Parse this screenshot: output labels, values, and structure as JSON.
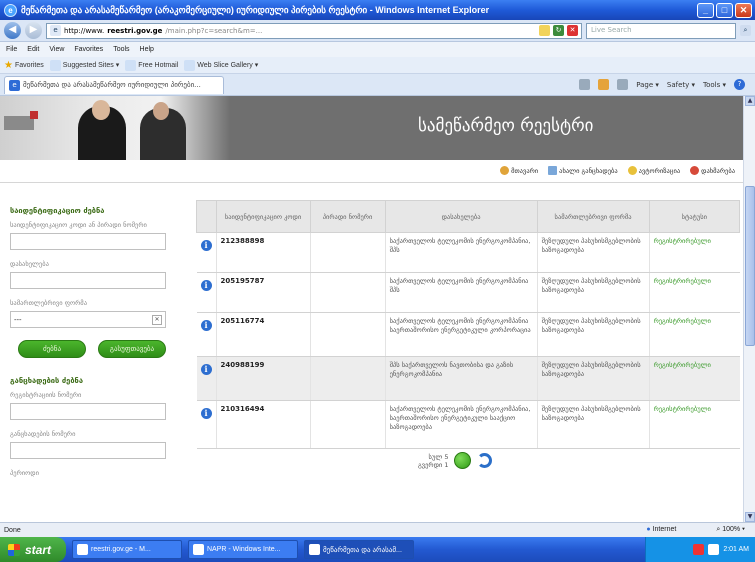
{
  "browser": {
    "title": "მეწარმეთა და არასამეწარმეო (არაკომერციული) იურიდიული პირების რეესტრი - Windows Internet Explorer",
    "url_http": "http://www.",
    "url_domain": "reestri.gov.ge",
    "url_path": "/main.php?c=search&m=...",
    "search_placeholder": "Live Search",
    "menu": [
      "File",
      "Edit",
      "View",
      "Favorites",
      "Tools",
      "Help"
    ],
    "favorites_label": "Favorites",
    "fav_items": [
      "Suggested Sites ▾",
      "Free Hotmail",
      "Web Slice Gallery ▾"
    ],
    "tab_title": "მეწარმეთა და არასამეწარმეო იურიდიული პირები...",
    "commands": [
      "Page ▾",
      "Safety ▾",
      "Tools ▾"
    ],
    "status_left": "Done",
    "status_zone": "Internet",
    "status_zoom": "100%"
  },
  "site": {
    "title": "სამეწარმეო რეესტრი",
    "toplinks": [
      "მთავარი",
      "ახალი განცხადება",
      "ავტორიზაცია",
      "დახმარება"
    ]
  },
  "sidebar": {
    "section1_title": "საიდენტიფიკაციო ძებნა",
    "field1_label": "საიდენტიფიკაციო კოდი ან პირადი ნომერი",
    "field2_label": "დასახელება",
    "field3_label": "სამართლებრივი ფორმა",
    "select_value": "---",
    "btn_search": "ძებნა",
    "btn_clear": "გასუფთავება",
    "section2_title": "განცხადების ძებნა",
    "field4_label": "რეგისტრაციის ნომერი",
    "field5_label": "განცხადების ნომერი",
    "field6_label": "პერიოდი"
  },
  "table": {
    "headers": [
      "საიდენტიფიკაციო კოდი",
      "პირადი ნომერი",
      "დასახელება",
      "სამართლებრივი ფორმა",
      "სტატუსი"
    ],
    "rows": [
      {
        "code": "212388898",
        "name": "საქართველოს ტელეკომის ენერგოკომპანია, შპს",
        "form": "შეზღუდული პასუხისმგებლობის საზოგადოება",
        "status": "რეგისტრირებული"
      },
      {
        "code": "205195787",
        "name": "საქართველოს ტელეკომის ენერგოკომპანია შპს",
        "form": "შეზღუდული პასუხისმგებლობის საზოგადოება",
        "status": "რეგისტრირებული"
      },
      {
        "code": "205116774",
        "name": "საქართველოს ტელეკომის ენერგოკომპანია საერთაშორისო ენერგეტიკული კორპორაცია",
        "form": "შეზღუდული პასუხისმგებლობის საზოგადოება",
        "status": "რეგისტრირებული"
      },
      {
        "code": "240988199",
        "name": "შპს საქართველოს ნავთობისა და გაზის ენერგოკომპანია",
        "form": "შეზღუდული პასუხისმგებლობის საზოგადოება",
        "status": "რეგისტრირებული"
      },
      {
        "code": "210316494",
        "name": "საქართველოს ტელეკომის ენერგოკომპანია, საერთაშორისო ენერგეტიკული სააქციო საზოგადოება",
        "form": "შეზღუდული პასუხისმგებლობის საზოგადოება",
        "status": "რეგისტრირებული"
      }
    ]
  },
  "pager": {
    "line1": "სულ 5",
    "line2": "გვერდი 1"
  },
  "taskbar": {
    "start": "start",
    "tasks": [
      "reestri.gov.ge - M...",
      "NAPR - Windows Inte...",
      "მეწარმეთა და არასამ..."
    ],
    "clock": "2:01 AM"
  }
}
